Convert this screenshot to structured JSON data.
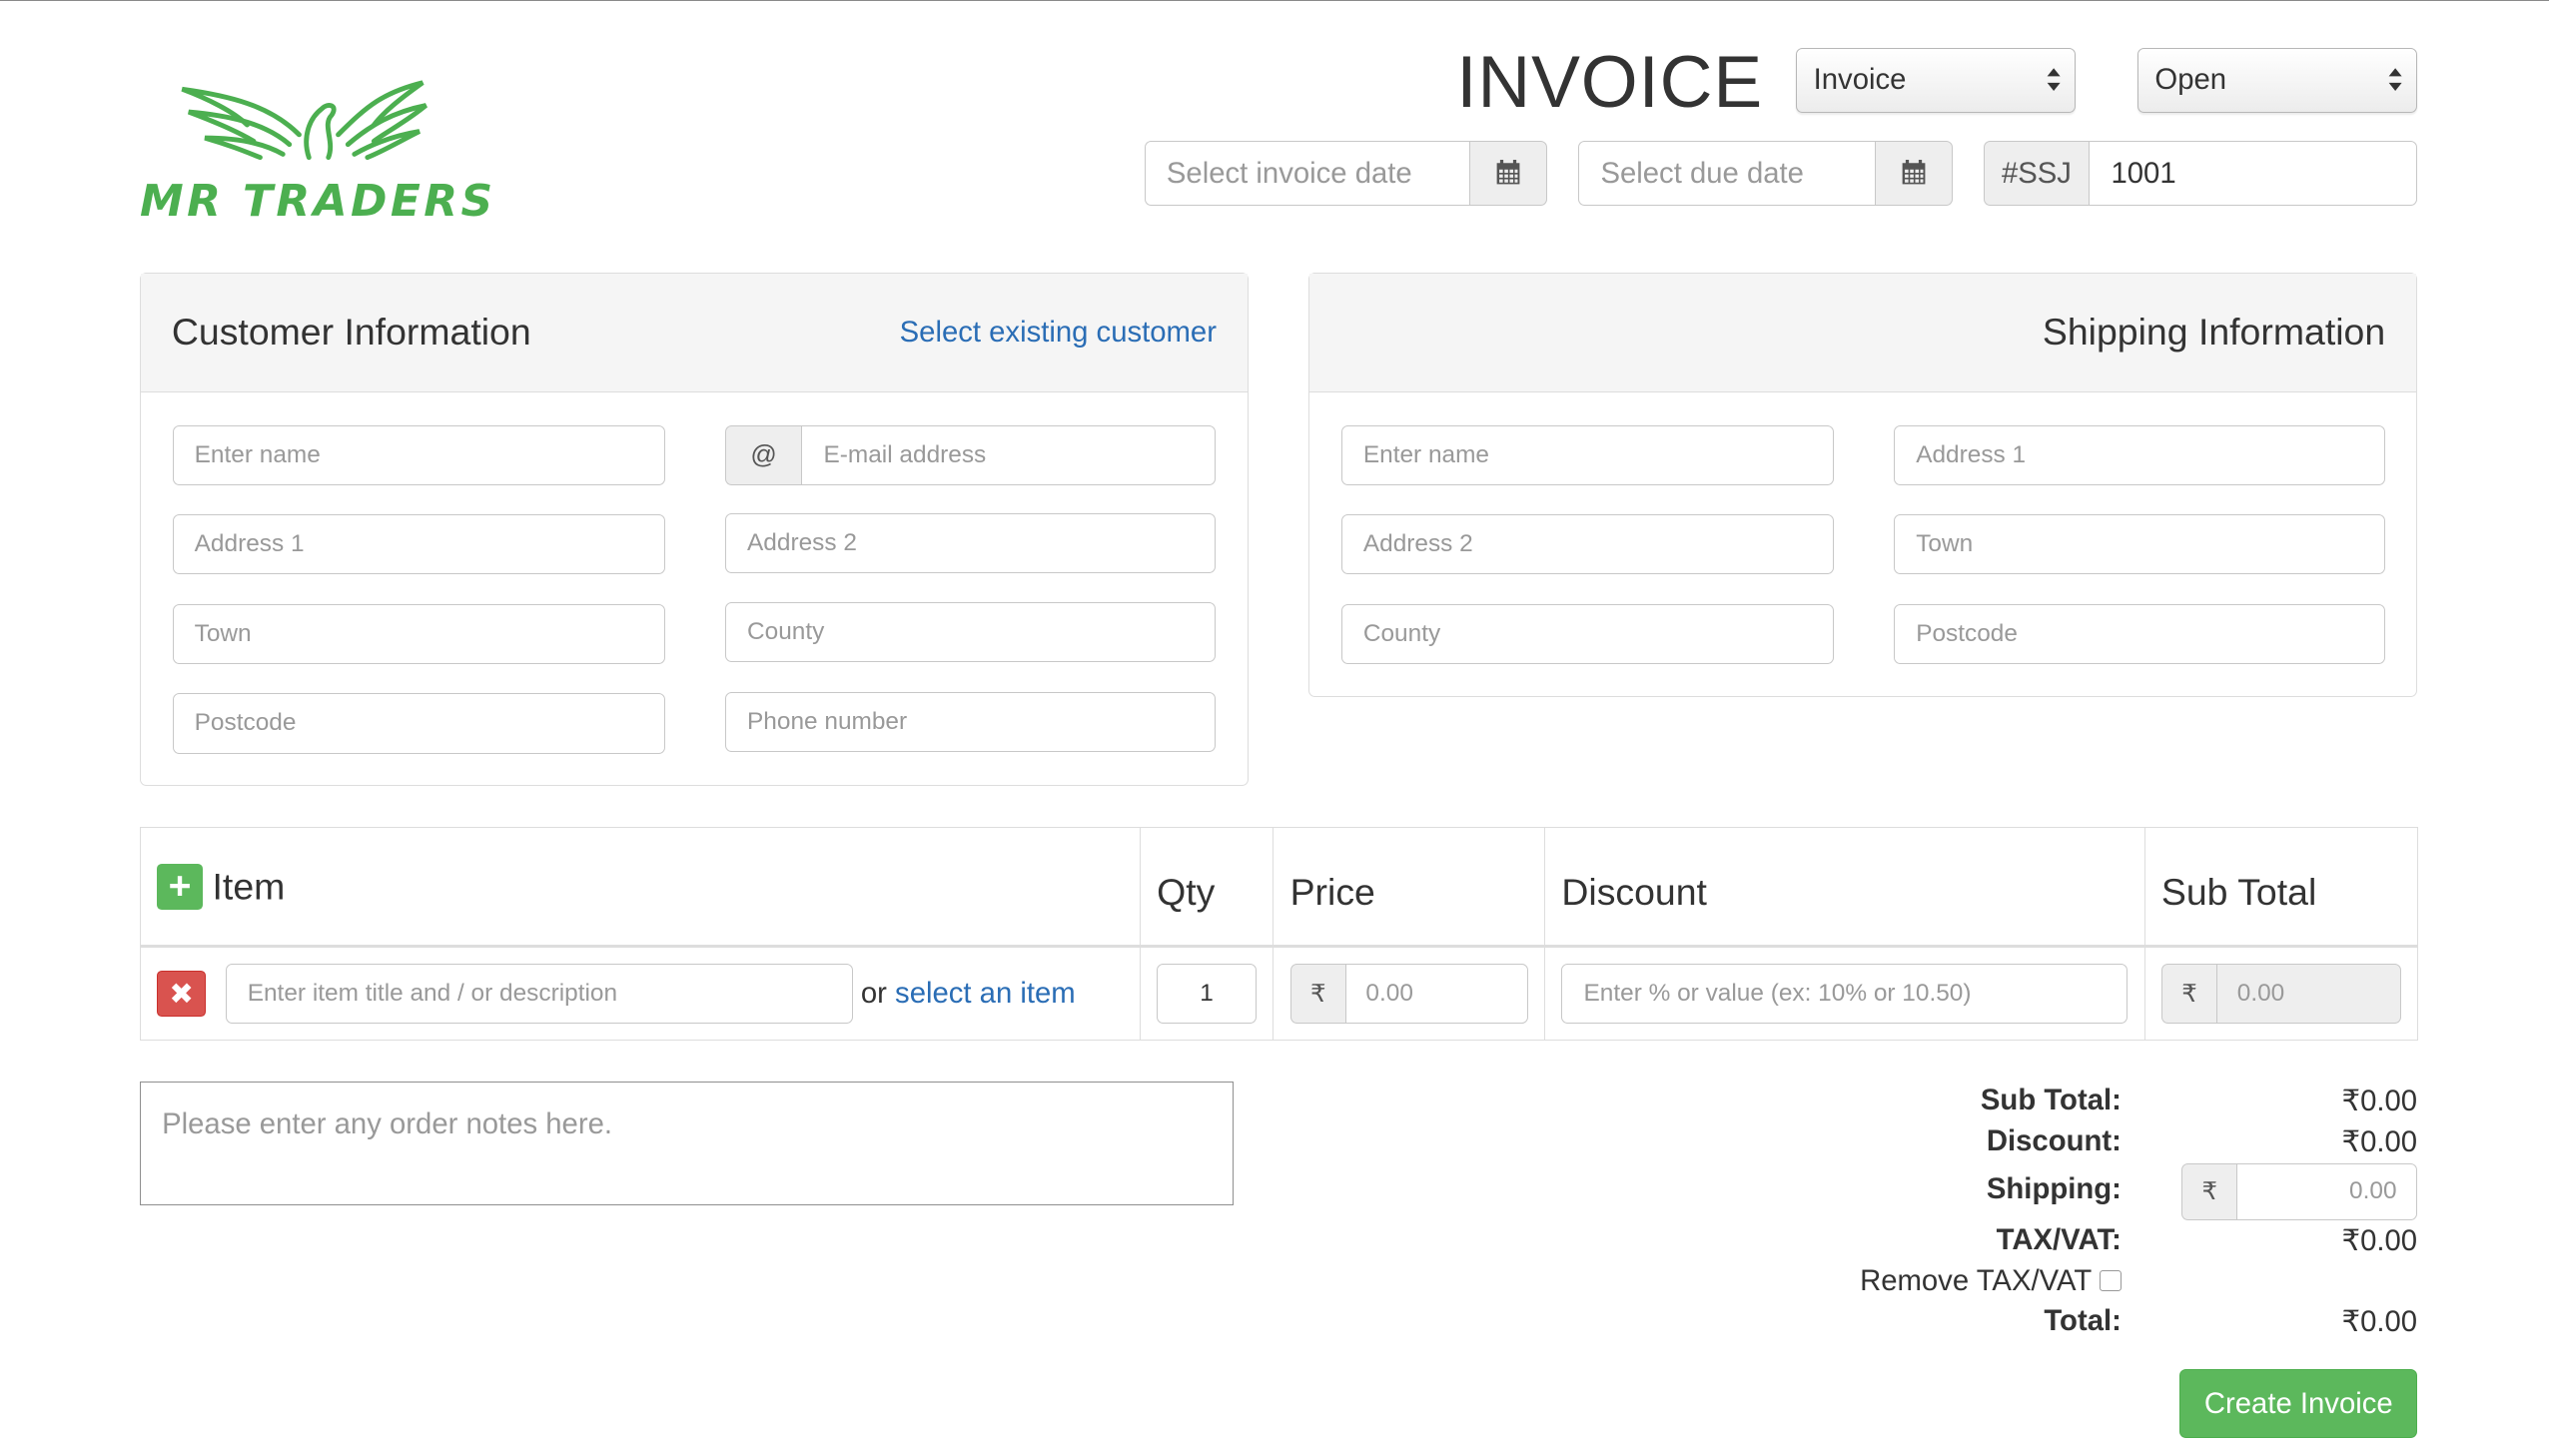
{
  "header": {
    "logo_text": "MR TRADERS",
    "title": "INVOICE",
    "type_select": "Invoice",
    "status_select": "Open",
    "invoice_date_placeholder": "Select invoice date",
    "due_date_placeholder": "Select due date",
    "invoice_prefix": "#SSJ",
    "invoice_number": "1001"
  },
  "customer": {
    "heading": "Customer Information",
    "select_link": "Select existing customer",
    "email_addon": "@",
    "fields": {
      "name": "Enter name",
      "email": "E-mail address",
      "address1": "Address 1",
      "address2": "Address 2",
      "town": "Town",
      "county": "County",
      "postcode": "Postcode",
      "phone": "Phone number"
    }
  },
  "shipping": {
    "heading": "Shipping Information",
    "fields": {
      "name": "Enter name",
      "address1": "Address 1",
      "address2": "Address 2",
      "town": "Town",
      "county": "County",
      "postcode": "Postcode"
    }
  },
  "items_table": {
    "headers": {
      "item": "Item",
      "qty": "Qty",
      "price": "Price",
      "discount": "Discount",
      "subtotal": "Sub Total"
    },
    "add_icon": "plus-icon",
    "row": {
      "delete_icon": "close-icon",
      "delete_glyph": "✖",
      "description_placeholder": "Enter item title and / or description",
      "or_text": "or",
      "select_item_link": "select an item",
      "qty_value": "1",
      "currency_symbol": "₹",
      "price_placeholder": "0.00",
      "discount_placeholder": "Enter % or value (ex: 10% or 10.50)",
      "subtotal_value": "0.00"
    }
  },
  "notes": {
    "placeholder": "Please enter any order notes here."
  },
  "totals": {
    "sub_total_label": "Sub Total:",
    "sub_total_value": "₹0.00",
    "discount_label": "Discount:",
    "discount_value": "₹0.00",
    "shipping_label": "Shipping:",
    "shipping_currency": "₹",
    "shipping_placeholder": "0.00",
    "tax_label": "TAX/VAT:",
    "tax_value": "₹0.00",
    "remove_tax_label": "Remove TAX/VAT",
    "total_label": "Total:",
    "total_value": "₹0.00"
  },
  "actions": {
    "create_invoice": "Create Invoice"
  },
  "colors": {
    "brand_green": "#4caf50",
    "link_blue": "#2a6db5",
    "danger_red": "#d9534f",
    "success_green": "#5cb85c"
  }
}
